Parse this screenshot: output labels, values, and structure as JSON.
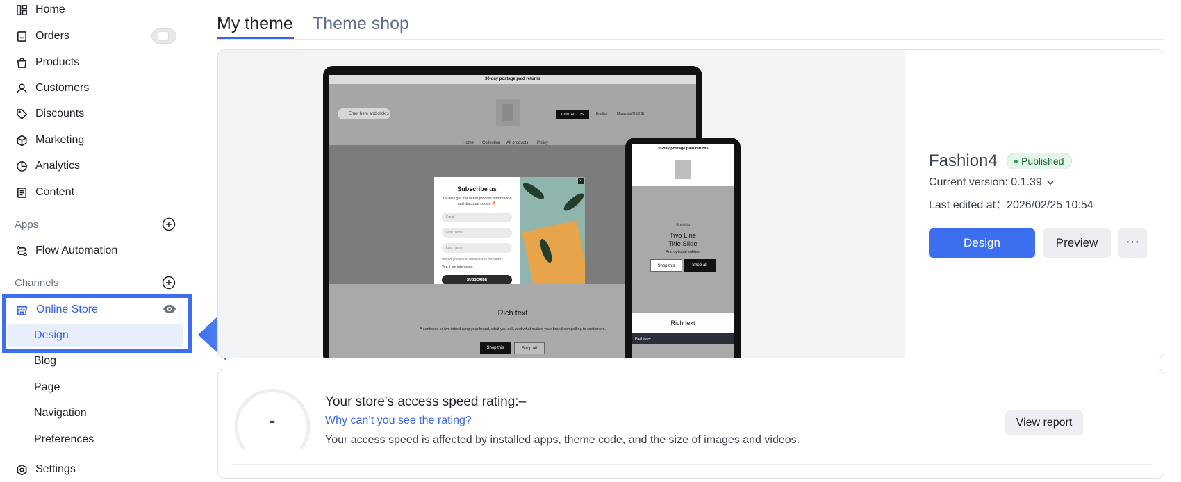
{
  "sidebar": {
    "items": [
      {
        "label": "Home",
        "icon": "home-icon"
      },
      {
        "label": "Orders",
        "icon": "orders-icon"
      },
      {
        "label": "Products",
        "icon": "bag-icon"
      },
      {
        "label": "Customers",
        "icon": "person-icon"
      },
      {
        "label": "Discounts",
        "icon": "tag-icon"
      },
      {
        "label": "Marketing",
        "icon": "cube-icon"
      },
      {
        "label": "Analytics",
        "icon": "pie-chart-icon"
      },
      {
        "label": "Content",
        "icon": "document-icon"
      }
    ],
    "apps_label": "Apps",
    "flow_automation": "Flow Automation",
    "channels_label": "Channels",
    "online_store": "Online Store",
    "sub_items": [
      "Design",
      "Blog",
      "Page",
      "Navigation",
      "Preferences"
    ],
    "settings": "Settings"
  },
  "tabs": {
    "my_theme": "My theme",
    "theme_shop": "Theme shop"
  },
  "preview": {
    "laptop": {
      "topbar": "30-day postage paid returns",
      "search": "Enter here and click s",
      "contact": "CONTACT US",
      "lang": "English",
      "currency": "Malaysia (USD $)",
      "nav": [
        "Home",
        "Collection",
        "All products",
        "Policy"
      ],
      "popup_title": "Subscribe us",
      "popup_desc": "You will get the latest product information and discount codes.🔥",
      "popup_fields": [
        "Email",
        "First name",
        "Last name"
      ],
      "popup_question": "Would you like to receive any discount?",
      "popup_check": "Yes, I am interested.",
      "popup_submit": "SUBSCRIBE",
      "rich_title": "Rich text",
      "rich_desc": "A sentence or two introducing your brand, what you sell, and what makes your brand compelling to customers.",
      "btn_shop_this": "Shop this",
      "btn_shop_all": "Shop all"
    },
    "phone": {
      "topbar": "30-day postage paid returns",
      "subtitle": "Subtitle",
      "title_line1": "Two Line",
      "title_line2": "Title Slide",
      "subtext": "And optional subtext",
      "btn_shop_this": "Shop this",
      "btn_shop_all": "Shop all",
      "rich_title": "Rich text",
      "bar_label": "Fashion4"
    }
  },
  "theme": {
    "name": "Fashion4",
    "status": "Published",
    "status_color": "#1f9d55",
    "version": "Current version: 0.1.39",
    "last_edited": "Last edited at：2026/02/25 10:54",
    "design_label": "Design",
    "preview_label": "Preview",
    "more_label": "···"
  },
  "speed": {
    "value": "-",
    "title": "Your store's access speed rating:–",
    "link": "Why can’t you see the rating?",
    "desc": "Your access speed is affected by installed apps, theme code, and the size of images and videos.",
    "report_label": "View report"
  },
  "colors": {
    "accent": "#3b6ff0",
    "highlight": "#3b6ff0"
  }
}
